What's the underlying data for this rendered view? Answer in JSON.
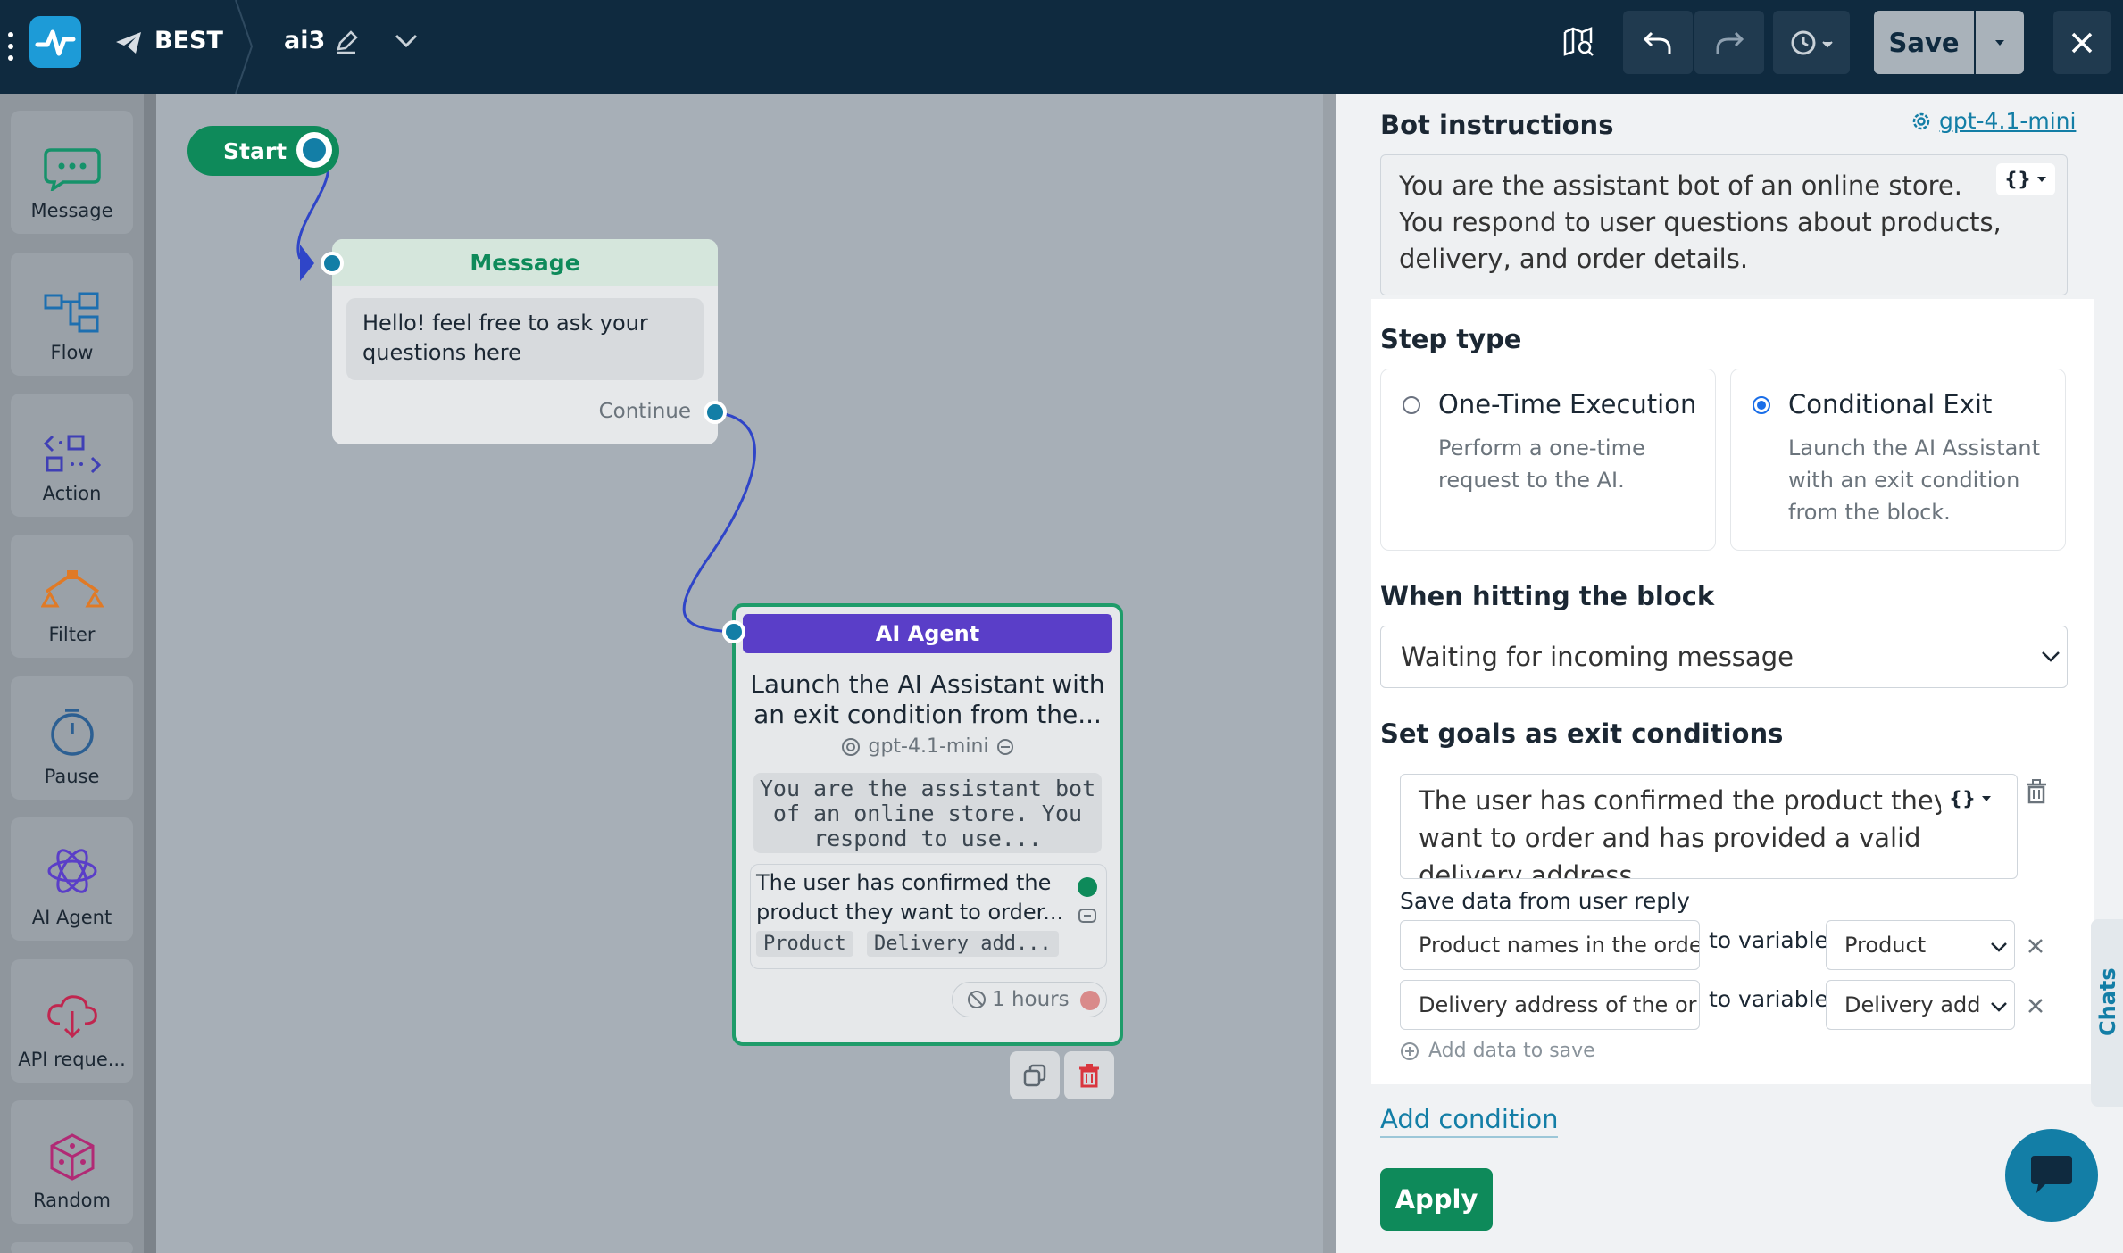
{
  "topbar": {
    "project_name": "BEST",
    "bot_name": "ai3",
    "save_label": "Save"
  },
  "sidebar": {
    "items": [
      {
        "label": "Message",
        "icon": "message-icon"
      },
      {
        "label": "Flow",
        "icon": "flow-icon"
      },
      {
        "label": "Action",
        "icon": "action-icon"
      },
      {
        "label": "Filter",
        "icon": "filter-icon"
      },
      {
        "label": "Pause",
        "icon": "pause-icon"
      },
      {
        "label": "AI Agent",
        "icon": "ai-agent-icon"
      },
      {
        "label": "API reque...",
        "icon": "api-request-icon"
      },
      {
        "label": "Random",
        "icon": "random-icon"
      }
    ]
  },
  "canvas": {
    "start_label": "Start",
    "message_node": {
      "title": "Message",
      "text": "Hello! feel free to ask your questions here",
      "continue_label": "Continue"
    },
    "ai_node": {
      "title": "AI Agent",
      "description_1": "Launch the AI Assistant with",
      "description_2": "an exit condition from the...",
      "model": "gpt-4.1-mini",
      "prompt_1": "You are the assistant bot",
      "prompt_2": "of an online store. You",
      "prompt_3": "respond to use...",
      "condition_1": "The user has confirmed the",
      "condition_2": "product they want to order...",
      "var_1": "Product",
      "var_2": "Delivery add...",
      "timeout": "1 hours"
    }
  },
  "panel": {
    "bot_instructions_label": "Bot instructions",
    "model_link": "gpt-4.1-mini",
    "instructions_1": "You are the assistant bot of an online store.",
    "instructions_2": "You respond to user questions about products,",
    "instructions_3": "delivery, and order details.",
    "step_type_label": "Step type",
    "options": [
      {
        "title": "One-Time Execution",
        "desc_1": "Perform a one-time",
        "desc_2": "request to the AI.",
        "selected": false
      },
      {
        "title": "Conditional Exit",
        "desc_1": "Launch the AI Assistant",
        "desc_2": "with an exit condition",
        "desc_3": "from the block.",
        "selected": true
      }
    ],
    "when_hitting_label": "When hitting the block",
    "when_hitting_value": "Waiting for incoming message",
    "goals_label": "Set goals as exit conditions",
    "goal_text_1": "The user has confirmed the product they",
    "goal_text_2": "want to order and has provided a valid",
    "goal_text_3": "delivery address",
    "save_data_label": "Save data from user reply",
    "rows": [
      {
        "source": "Product names in the orde",
        "to_label": "to variable",
        "variable": "Product"
      },
      {
        "source": "Delivery address of the or",
        "to_label": "to variable",
        "variable": "Delivery add"
      }
    ],
    "add_data_label": "Add data to save",
    "add_condition_label": "Add condition",
    "apply_label": "Apply",
    "chats_tab": "Chats"
  },
  "colors": {
    "topbar": "#0f2a3f",
    "accent_green": "#0e8a5a",
    "ai_purple": "#5a3ec8",
    "link_blue": "#137ea6",
    "delete_red": "#d9363e"
  }
}
